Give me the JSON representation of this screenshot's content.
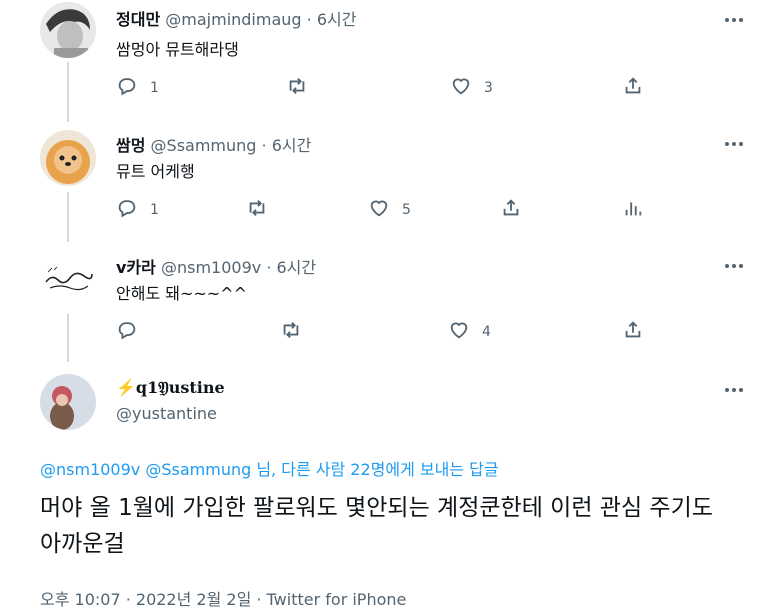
{
  "tweets": [
    {
      "name": "정대만",
      "handle": "@majmindimaug",
      "dot": "·",
      "time": "6시간",
      "text": "쌈멍아 뮤트해라댕",
      "replies": "1",
      "likes": "3",
      "retweets": ""
    },
    {
      "name": "쌈멍",
      "handle": "@Ssammung",
      "dot": "·",
      "time": "6시간",
      "text": "뮤트 어케행",
      "replies": "1",
      "likes": "5",
      "retweets": ""
    },
    {
      "name": "v카라",
      "handle": "@nsm1009v",
      "dot": "·",
      "time": "6시간",
      "text": "안해도 돼~~~^^",
      "replies": "",
      "likes": "4",
      "retweets": ""
    }
  ],
  "main_tweet": {
    "name": "⚡q1𝔜ustine",
    "handle": "@yustantine",
    "reply_to": {
      "mention1": "@nsm1009v",
      "mention2": "@Ssammung",
      "suffix": " 님, 다른 사람 22명에게 보내는 답글"
    },
    "text": "머야 올 1월에 가입한 팔로워도 몇안되는 계정쿤한테 이런 관심 주기도 아까운걸",
    "meta": "오후 10:07 · 2022년 2월 2일 · Twitter for iPhone"
  },
  "colors": {
    "accent": "#1d9bf0",
    "secondary": "#536471",
    "line": "#cfd9de"
  }
}
